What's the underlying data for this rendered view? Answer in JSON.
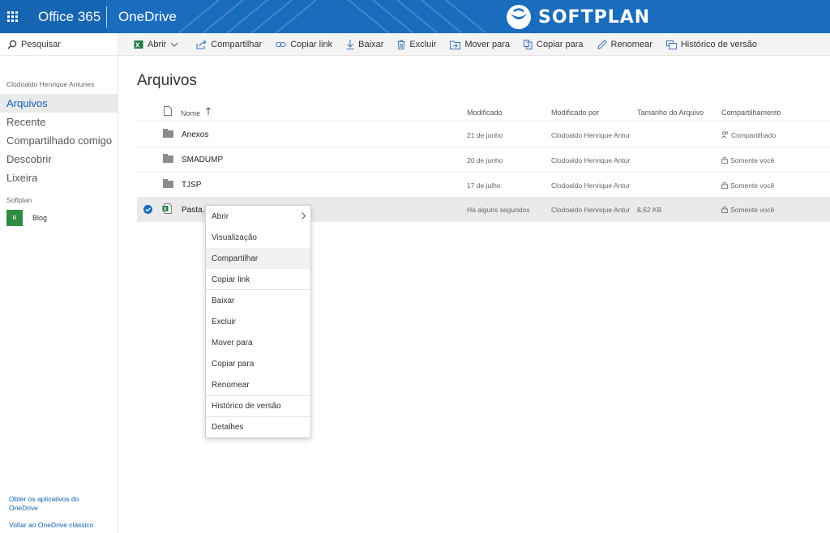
{
  "suite": {
    "brand": "Office 365",
    "app": "OneDrive",
    "logo_text": "SOFTPLAN",
    "bar_color": "#1a6cbd"
  },
  "search": {
    "label": "Pesquisar"
  },
  "commands": [
    {
      "label": "Abrir",
      "icon": "excel-icon"
    },
    {
      "label": "Compartilhar",
      "icon": "share-icon"
    },
    {
      "label": "Copiar link",
      "icon": "link-icon"
    },
    {
      "label": "Baixar",
      "icon": "download-icon"
    },
    {
      "label": "Excluir",
      "icon": "trash-icon"
    },
    {
      "label": "Mover para",
      "icon": "move-icon"
    },
    {
      "label": "Copiar para",
      "icon": "copy-icon"
    },
    {
      "label": "Renomear",
      "icon": "pencil-icon"
    },
    {
      "label": "Histórico de versão",
      "icon": "history-icon"
    }
  ],
  "nav": {
    "user": "Clodoaldo Henrique Antunes",
    "items": [
      {
        "label": "Arquivos",
        "active": true
      },
      {
        "label": "Recente"
      },
      {
        "label": "Compartilhado comigo"
      },
      {
        "label": "Descobrir"
      },
      {
        "label": "Lixeira"
      }
    ],
    "group": "Softplan",
    "site": {
      "tile": "B",
      "label": "Blog"
    },
    "footer": [
      "Obter os aplicativos do OneDrive",
      "Voltar ao OneDrive clássico"
    ]
  },
  "main": {
    "title": "Arquivos",
    "columns": {
      "name": "Nome",
      "modified": "Modificado",
      "modified_by": "Modificado por",
      "size": "Tamanho do Arquivo",
      "sharing": "Compartilhamento"
    },
    "rows": [
      {
        "name": "Anexos",
        "modified": "21 de junho",
        "modified_by": "Clodoaldo Henrique Antur",
        "size": "",
        "sharing": "Compartilhado"
      },
      {
        "name": "SMADUMP",
        "modified": "20 de junho",
        "modified_by": "Clodoaldo Henrique Antur",
        "size": "",
        "sharing": "Somente você"
      },
      {
        "name": "TJSP",
        "modified": "17 de julho",
        "modified_by": "Clodoaldo Henrique Antur",
        "size": "",
        "sharing": "Somente você"
      },
      {
        "name": "Pasta.x",
        "modified": "Há alguns segundos",
        "modified_by": "Clodoaldo Henrique Antur",
        "size": "8,62 KB",
        "sharing": "Somente você"
      }
    ]
  },
  "context_menu": [
    "Abrir",
    "Visualização",
    "Compartilhar",
    "Copiar link",
    "Baixar",
    "Excluir",
    "Mover para",
    "Copiar para",
    "Renomear",
    "Histórico de versão",
    "Detalhes"
  ]
}
